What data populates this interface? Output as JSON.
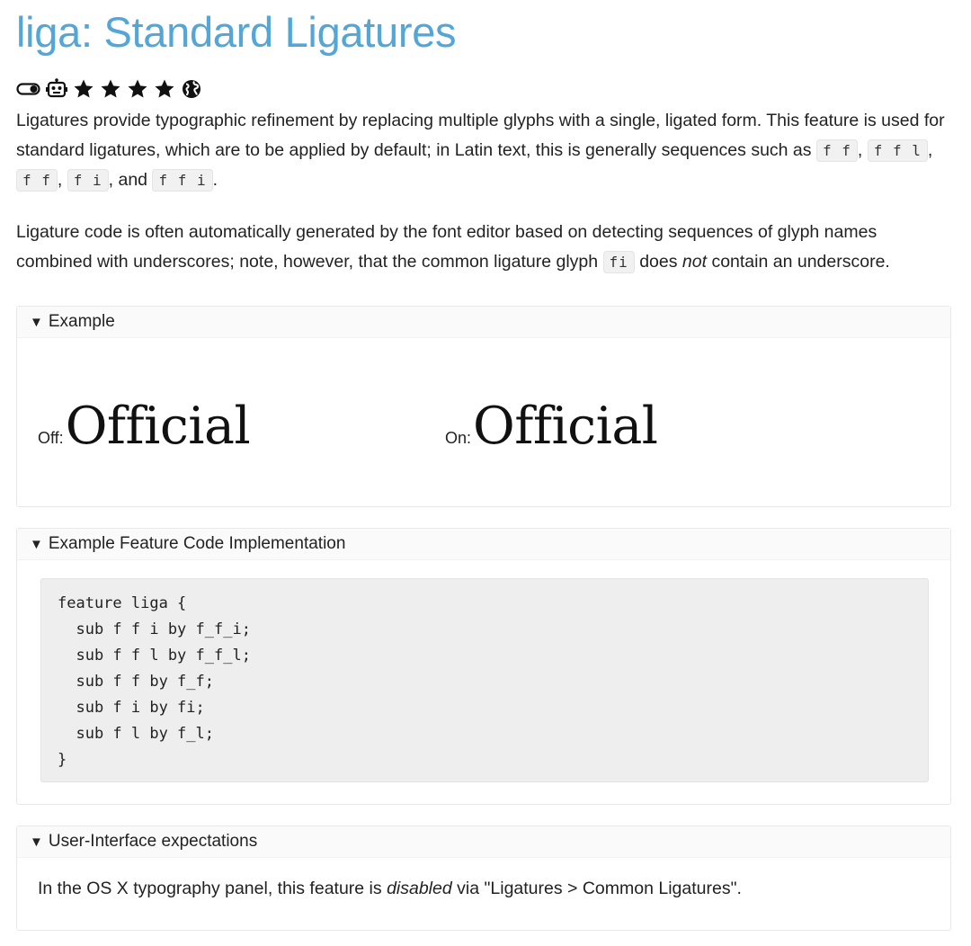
{
  "page": {
    "title": "liga: Standard Ligatures",
    "icons": [
      "toggle-icon",
      "robot-icon",
      "star-icon",
      "star-icon",
      "star-icon",
      "star-icon",
      "globe-icon"
    ],
    "rating": 4,
    "paragraph1": {
      "text_a": "Ligatures provide typographic refinement by replacing multiple glyphs with a single, ligated form. This feature is used for standard ligatures, which are to be applied by default; in Latin text, this is generally sequences such as ",
      "code1": "f f",
      "sep1": ",",
      "code2": "f f l",
      "sep2": ",",
      "code3": "f f",
      "sep3": ",",
      "code4": "f i",
      "sep4": ", and",
      "code5": "f f i",
      "end": "."
    },
    "paragraph2": {
      "text_a": "Ligature code is often automatically generated by the font editor based on detecting sequences of glyph names combined with underscores; note, however, that the common ligature glyph ",
      "code": "fi",
      "text_b": " does ",
      "emph": "not",
      "text_c": " contain an underscore."
    }
  },
  "example": {
    "summary": "Example",
    "off_label": "Off:",
    "off_word": "Official",
    "on_label": "On:",
    "on_word": "Official"
  },
  "feature_code": {
    "summary": "Example Feature Code Implementation",
    "lines": [
      "feature liga {",
      "  sub f f i by f_f_i;",
      "  sub f f l by f_f_l;",
      "  sub f f by f_f;",
      "  sub f i by fi;",
      "  sub f l by f_l;",
      "}"
    ]
  },
  "ui_expectations": {
    "summary": "User-Interface expectations",
    "text_a": "In the OS X typography panel, this feature is ",
    "emph": "disabled",
    "text_b": " via \"Ligatures > Common Ligatures\"."
  },
  "colors": {
    "title": "#53a6d5",
    "text": "#222222",
    "code_bg": "#eeeeee"
  }
}
